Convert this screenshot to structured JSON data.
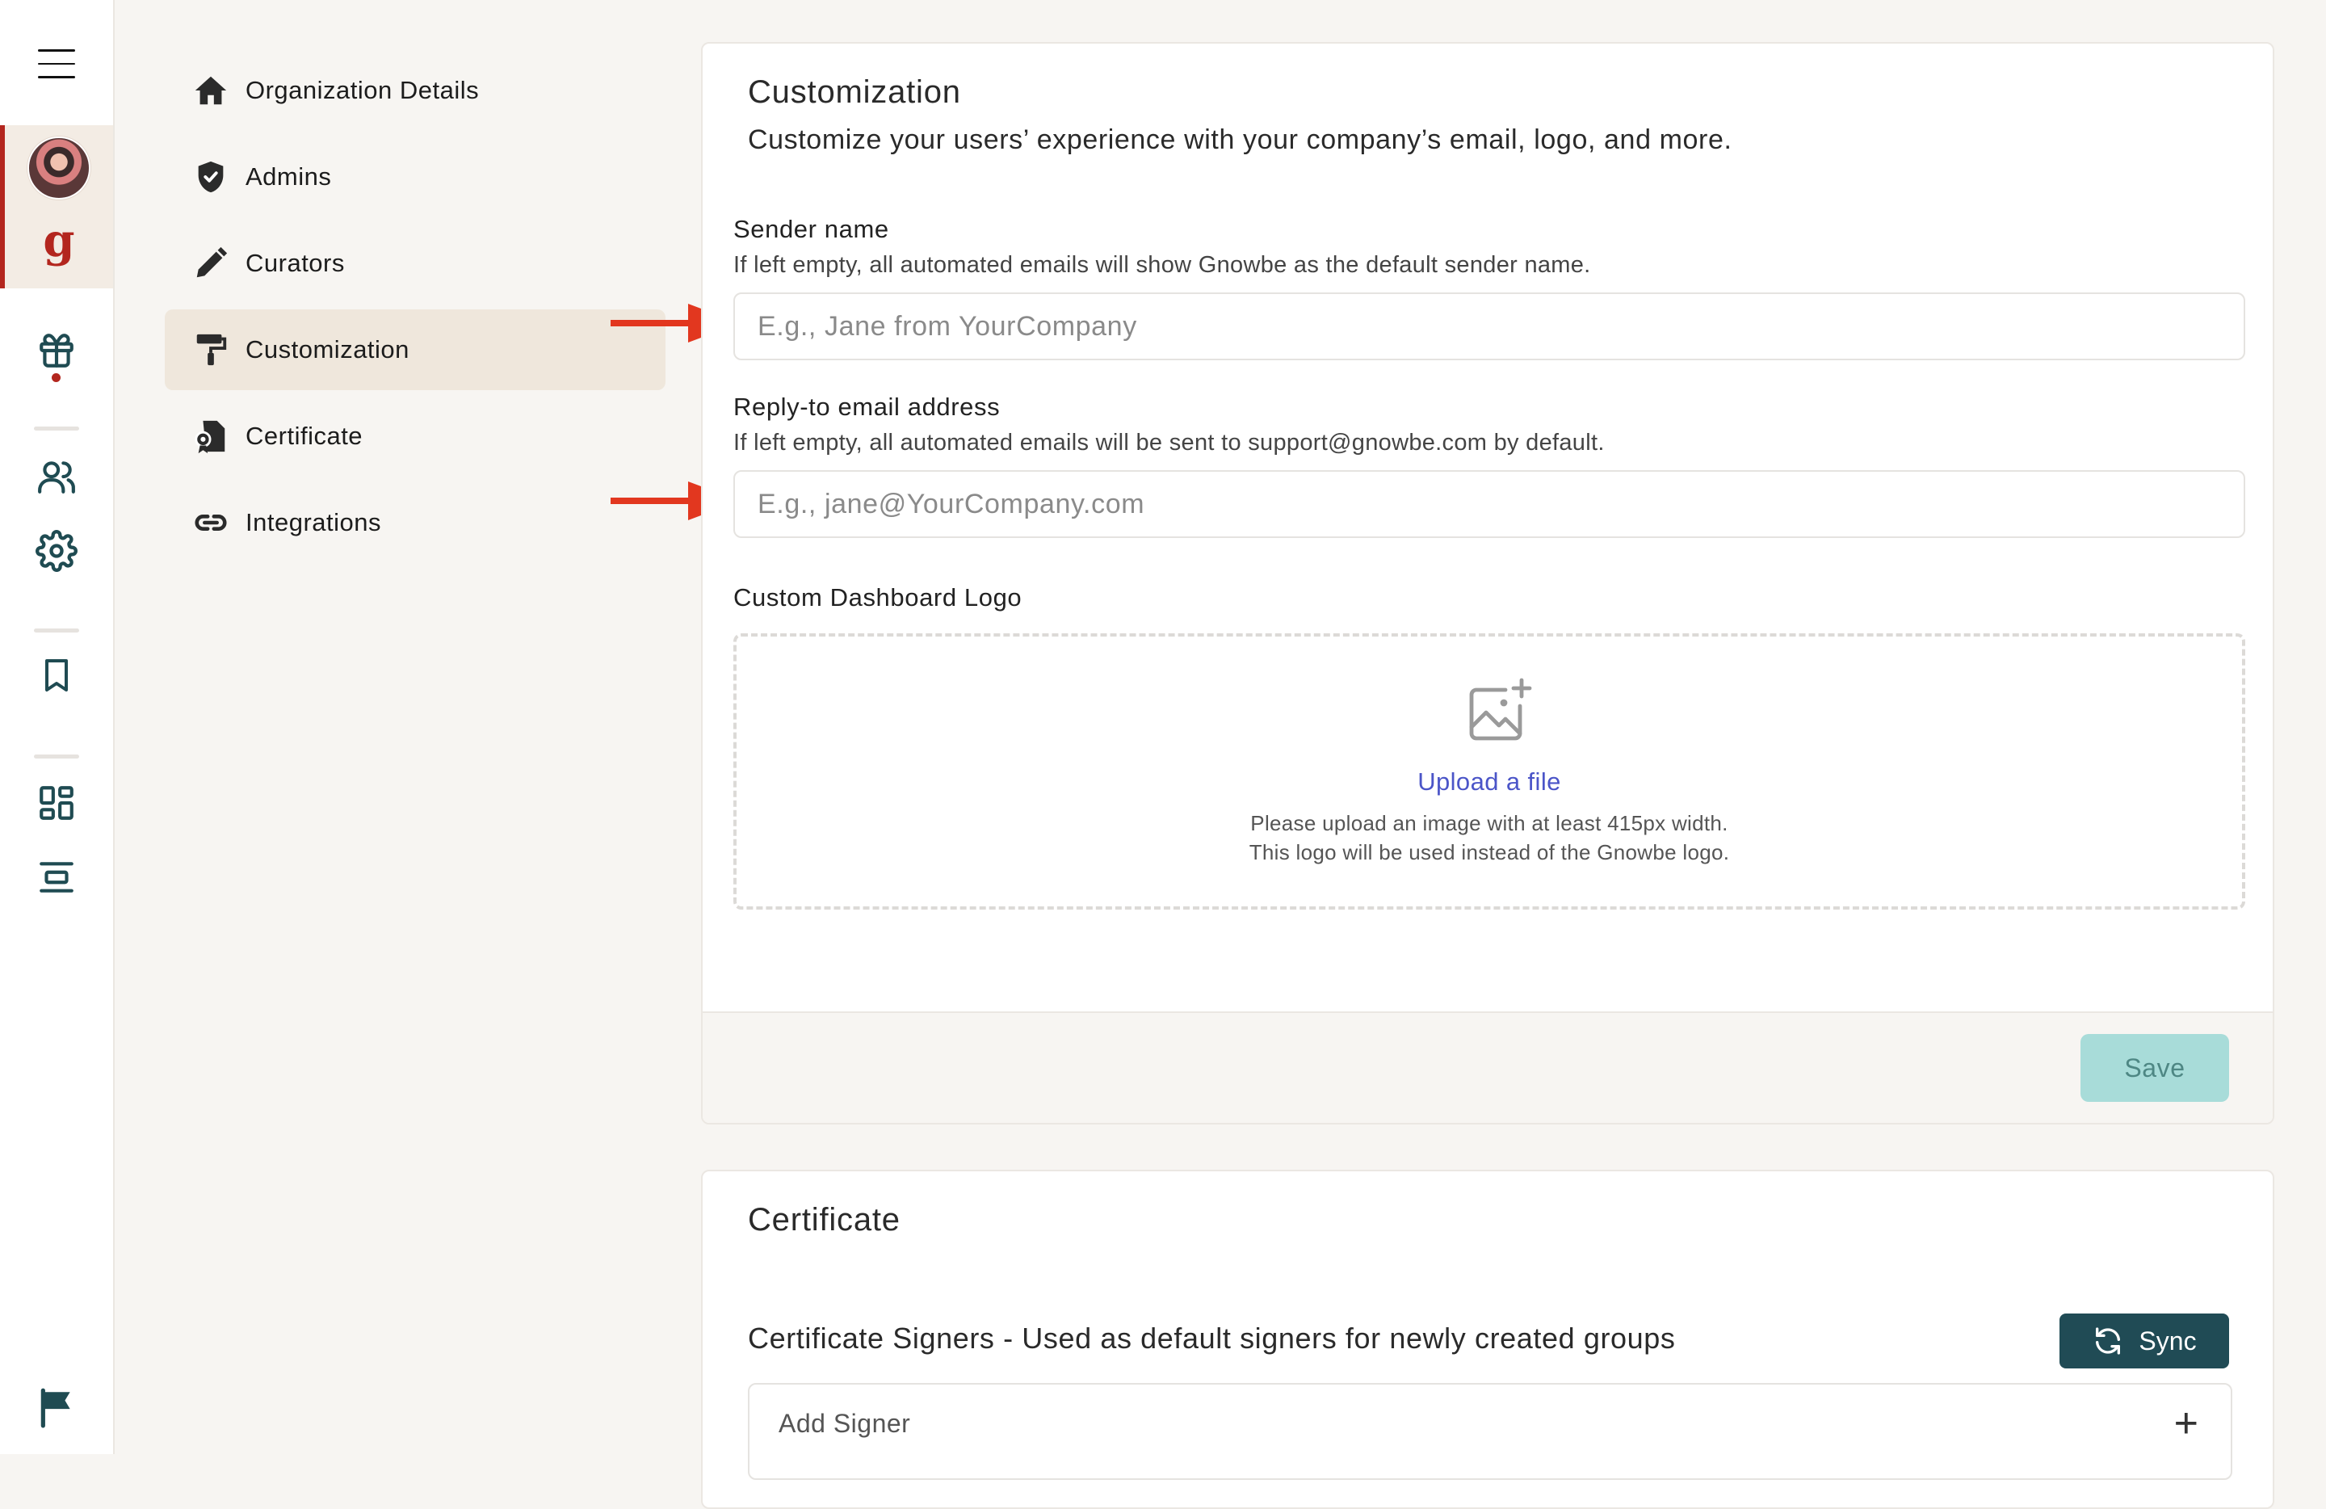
{
  "rail": {
    "org_logo_letter": "g",
    "icons": [
      "menu-icon",
      "gift-icon",
      "users-icon",
      "gear-icon",
      "bookmark-icon",
      "dashboard-icon",
      "layout-icon",
      "flag-icon"
    ]
  },
  "subnav": {
    "items": [
      {
        "label": "Organization Details",
        "icon": "home-icon"
      },
      {
        "label": "Admins",
        "icon": "shield-check-icon"
      },
      {
        "label": "Curators",
        "icon": "pencil-icon"
      },
      {
        "label": "Customization",
        "icon": "paint-roller-icon",
        "active": true
      },
      {
        "label": "Certificate",
        "icon": "certificate-icon"
      },
      {
        "label": "Integrations",
        "icon": "link-icon"
      }
    ]
  },
  "customization": {
    "title": "Customization",
    "subtitle": "Customize your users’ experience with your company’s email, logo, and more.",
    "sender_name": {
      "label": "Sender name",
      "help": "If left empty, all automated emails will show Gnowbe as the default sender name.",
      "placeholder": "E.g., Jane from YourCompany",
      "value": ""
    },
    "reply_to": {
      "label": "Reply-to email address",
      "help": "If left empty, all automated emails will be sent to support@gnowbe.com by default.",
      "placeholder": "E.g., jane@YourCompany.com",
      "value": ""
    },
    "logo": {
      "label": "Custom Dashboard Logo",
      "upload_link": "Upload a file",
      "hint_line1": "Please upload an image with at least 415px width.",
      "hint_line2": "This logo will be used instead of the Gnowbe logo."
    },
    "save_label": "Save"
  },
  "certificate": {
    "title": "Certificate",
    "signers_label": "Certificate Signers - Used as default signers for newly created groups",
    "sync_label": "Sync",
    "add_signer_label": "Add Signer",
    "add_signer_icon": "+"
  },
  "colors": {
    "accent_red": "#b3261e",
    "teal_dark": "#204b55",
    "teal_light": "#a8dcd9",
    "link_blue": "#4b55c8",
    "annotation_arrow": "#e2371f"
  }
}
